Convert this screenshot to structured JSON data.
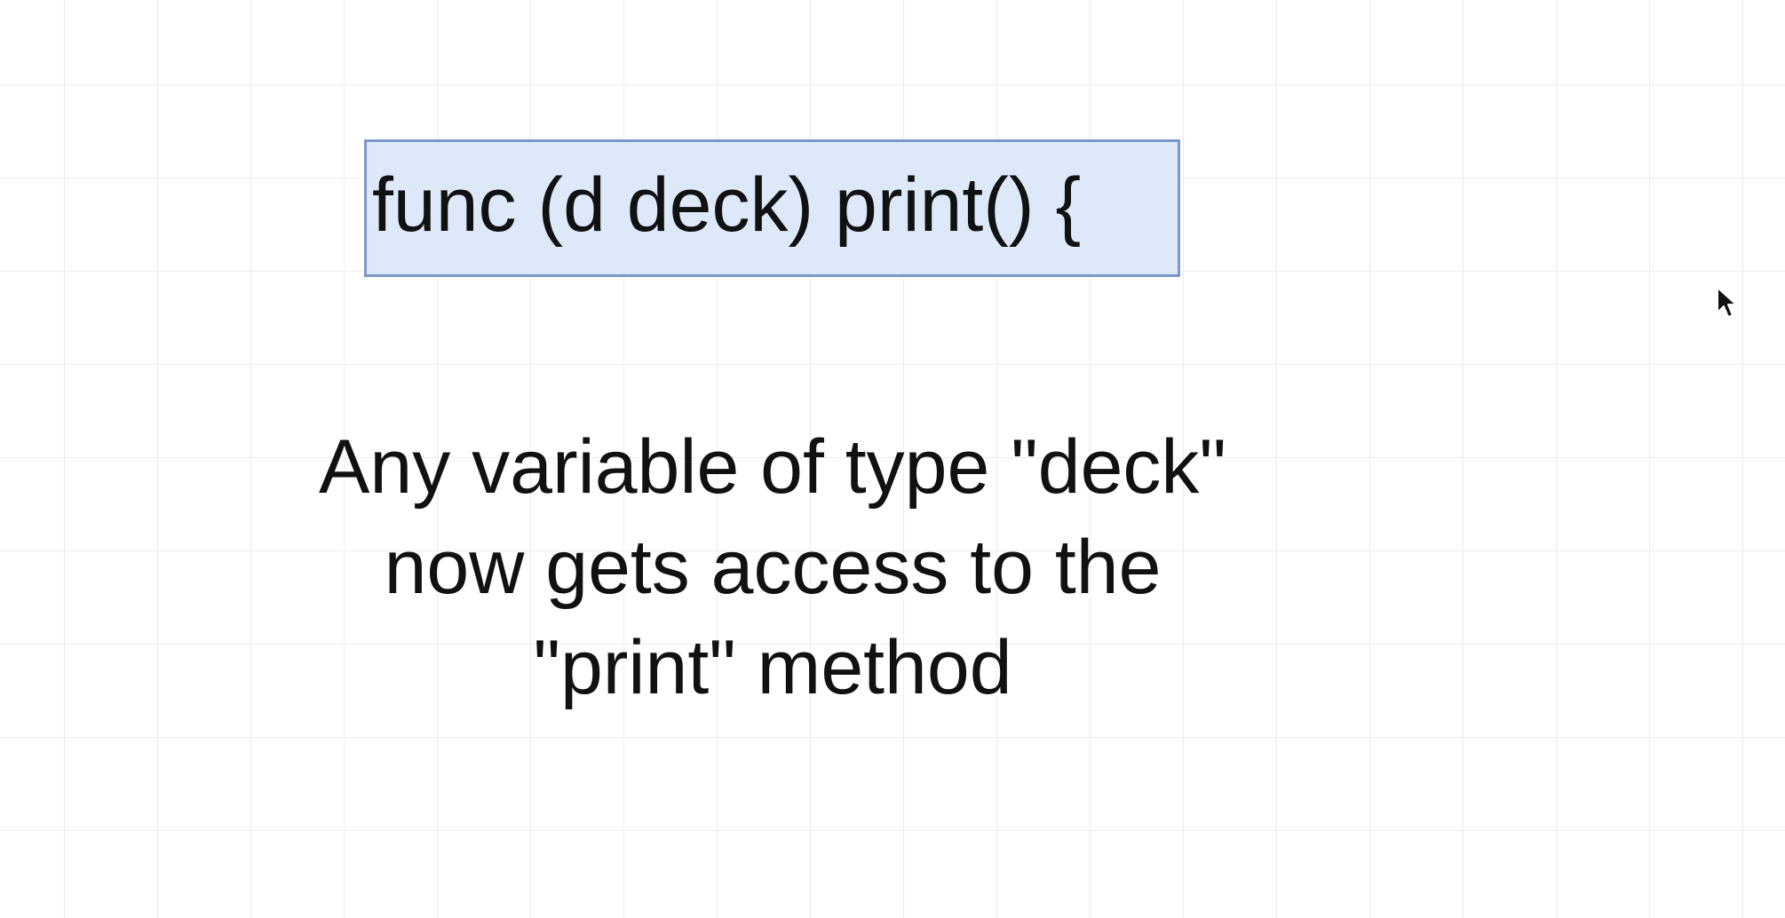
{
  "code_box": {
    "text": "func (d deck) print() {"
  },
  "caption": {
    "lines": [
      "Any variable of type \"deck\"",
      "now gets access to the",
      "\"print\" method"
    ]
  },
  "colors": {
    "background": "#ffffff",
    "grid_line": "#ececec",
    "box_fill": "#dde8f8",
    "box_border": "#7d97c7",
    "text": "#111111"
  },
  "icons": {
    "cursor": "mouse-pointer-icon"
  }
}
